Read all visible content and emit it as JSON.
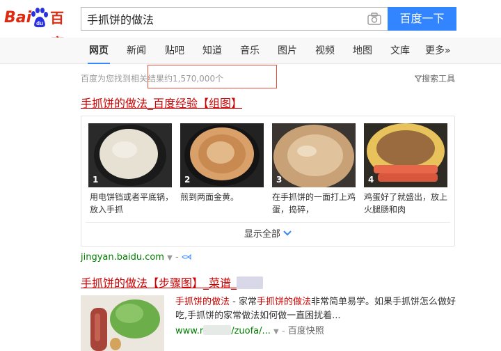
{
  "logo": {
    "latin": "Bai",
    "paw_text": "du",
    "cn": "百度"
  },
  "search": {
    "query": "手抓饼的做法",
    "button": "百度一下"
  },
  "nav": {
    "tabs": [
      "网页",
      "新闻",
      "贴吧",
      "知道",
      "音乐",
      "图片",
      "视频",
      "地图",
      "文库",
      "更多»"
    ],
    "active_index": 0
  },
  "result_count": "百度为您找到相关结果约1,570,000个",
  "search_tools": "搜索工具",
  "result1": {
    "title_main": "手抓饼的做法",
    "title_rest": "_百度经验【组图】",
    "steps": [
      {
        "num": "1",
        "caption": "用电饼铛或者平底锅，放入手抓"
      },
      {
        "num": "2",
        "caption": "煎到两面金黄。"
      },
      {
        "num": "3",
        "caption": "在手抓饼的一面打上鸡蛋，捣碎，"
      },
      {
        "num": "4",
        "caption": "鸡蛋好了就盛出，放上火腿肠和肉"
      }
    ],
    "show_all": "显示全部",
    "url": "jingyan.baidu.com"
  },
  "result2": {
    "title_main": "手抓饼的做法",
    "title_rest": "【步骤图】_菜谱_",
    "abstract_em1": "手抓饼的做法",
    "abstract_t1": " - 家常",
    "abstract_em2": "手抓饼的做法",
    "abstract_t2": "非常简单易学。如果手抓饼怎么做好吃,手抓饼的家常做法如何做一直困扰着...",
    "url_prefix": "www.r",
    "url_suffix": "/zuofa/...",
    "snapshot": "百度快照"
  },
  "colors": {
    "brand_red": "#de2910",
    "brand_blue": "#3385ff",
    "link_red": "#c00",
    "url_green": "#008000"
  }
}
